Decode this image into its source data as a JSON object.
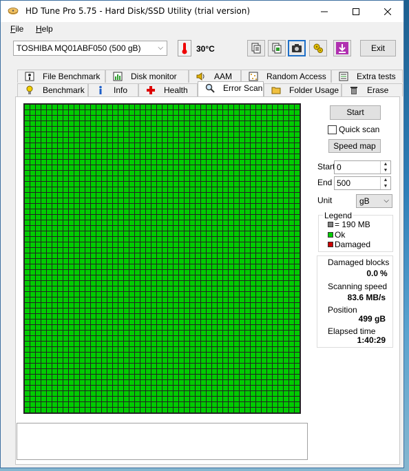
{
  "window": {
    "title": "HD Tune Pro 5.75 - Hard Disk/SSD Utility (trial version)"
  },
  "menu": {
    "file_rest": "ile",
    "file_first": "F",
    "help_first": "H",
    "help_rest": "elp"
  },
  "toolbar": {
    "drive": "TOSHIBA MQ01ABF050 (500 gB)",
    "temperature": "30°C",
    "exit_label": "Exit",
    "icons": [
      "copy-text-icon",
      "copy-screenshot-icon",
      "camera-icon",
      "settings-icon",
      "download-icon"
    ]
  },
  "tabs": {
    "row1": [
      "File Benchmark",
      "Disk monitor",
      "AAM",
      "Random Access",
      "Extra tests"
    ],
    "row2": [
      "Benchmark",
      "Info",
      "Health",
      "Error Scan",
      "Folder Usage",
      "Erase"
    ],
    "selected": "Error Scan"
  },
  "scan": {
    "start_button": "Start",
    "quick_scan_label": "Quick scan",
    "quick_scan_checked": false,
    "speed_map_button": "Speed map",
    "start_label": "Start",
    "start_value": "0",
    "end_label": "End",
    "end_value": "500",
    "unit_label": "Unit",
    "unit_value": "gB"
  },
  "legend": {
    "title": "Legend",
    "block_size": "= 190 MB",
    "ok": "Ok",
    "damaged": "Damaged",
    "colors": {
      "block": "#808080",
      "ok": "#00cc00",
      "damaged": "#cc0000"
    }
  },
  "stats": {
    "damaged_blocks_label": "Damaged blocks",
    "damaged_blocks_value": "0.0",
    "damaged_blocks_unit": "%",
    "scanning_speed_label": "Scanning speed",
    "scanning_speed_value": "83.6 MB/s",
    "position_label": "Position",
    "position_value": "499 gB",
    "elapsed_label": "Elapsed time",
    "elapsed_value": "1:40:29"
  }
}
